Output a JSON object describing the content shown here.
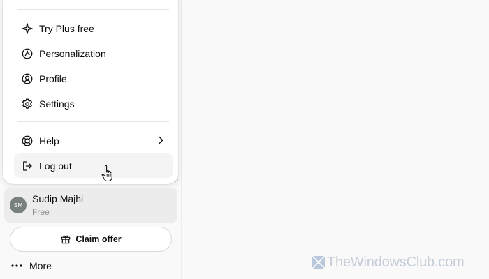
{
  "menu": {
    "items": [
      {
        "label": "Try Plus free",
        "icon": "sparkle-icon"
      },
      {
        "label": "Personalization",
        "icon": "personalization-icon"
      },
      {
        "label": "Profile",
        "icon": "profile-icon"
      },
      {
        "label": "Settings",
        "icon": "gear-icon"
      },
      {
        "label": "Help",
        "icon": "lifebuoy-icon"
      },
      {
        "label": "Log out",
        "icon": "logout-icon"
      }
    ]
  },
  "user": {
    "initials": "SM",
    "name": "Sudip Majhi",
    "plan": "Free",
    "avatar_color": "#78817e"
  },
  "claim_offer": {
    "label": "Claim offer",
    "icon": "gift-icon"
  },
  "more": {
    "label": "More",
    "icon": "ellipsis-icon"
  },
  "watermark": {
    "text": "TheWindowsClub.com"
  },
  "colors": {
    "hover": "#f4f4f4",
    "selected_row": "#ececec",
    "text": "#0d0d0d",
    "muted": "#8f8f8f"
  }
}
